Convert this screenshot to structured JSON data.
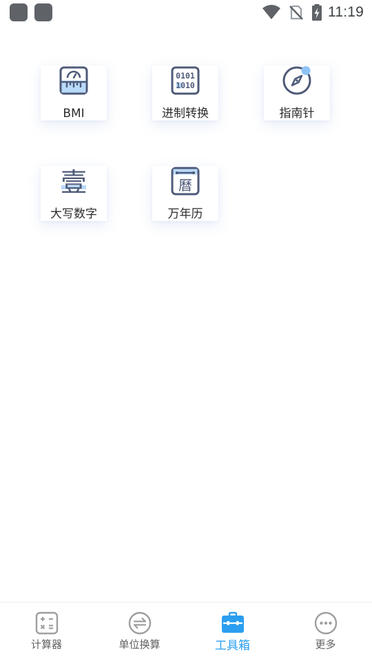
{
  "status_bar": {
    "time": "11:19",
    "icons": [
      "notification-app-icon",
      "notification-app-icon",
      "wifi-icon",
      "no-sim-icon",
      "battery-charging-icon"
    ]
  },
  "tools": [
    {
      "label": "BMI",
      "icon": "bmi-scale-icon"
    },
    {
      "label": "进制转换",
      "icon": "binary-convert-icon"
    },
    {
      "label": "指南针",
      "icon": "compass-icon"
    },
    {
      "label": "大写数字",
      "icon": "chinese-numeral-icon",
      "glyph": "壹"
    },
    {
      "label": "万年历",
      "icon": "calendar-icon",
      "glyph": "曆"
    }
  ],
  "bottom_nav": {
    "items": [
      {
        "label": "计算器",
        "icon": "calculator-icon",
        "active": false
      },
      {
        "label": "单位换算",
        "icon": "unit-convert-icon",
        "active": false
      },
      {
        "label": "工具箱",
        "icon": "toolbox-icon",
        "active": true
      },
      {
        "label": "更多",
        "icon": "more-icon",
        "active": false
      }
    ]
  },
  "colors": {
    "icon_stroke": "#4e5a78",
    "icon_accent": "#8fc3f5",
    "active_tab": "#2b9ef0",
    "inactive_tab": "#9e9e9e",
    "status_icons": "#5f6368"
  }
}
